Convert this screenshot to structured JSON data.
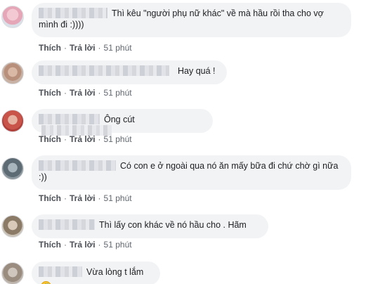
{
  "comments": [
    {
      "text": "Thì kêu \"người phụ nữ khác\" về mà hầu rồi tha cho vợ mình đi :))))",
      "actions": {
        "like": "Thích",
        "reply": "Trả lời",
        "time": "51 phút"
      }
    },
    {
      "text": "Hay quá !",
      "actions": {
        "like": "Thích",
        "reply": "Trả lời",
        "time": "51 phút"
      }
    },
    {
      "text": "Ông cút",
      "actions": {
        "like": "Thích",
        "reply": "Trả lời",
        "time": "51 phút"
      }
    },
    {
      "text": "Có con e ở ngoài qua nó ăn mấy bữa đi chứ chờ gì nữa :))",
      "actions": {
        "like": "Thích",
        "reply": "Trả lời",
        "time": "51 phút"
      }
    },
    {
      "text": "Thì lấy con khác về nó hầu cho . Hãm",
      "actions": {
        "like": "Thích",
        "reply": "Trả lời",
        "time": "51 phút"
      }
    },
    {
      "text": "Vừa lòng t lắm",
      "emoji": "rolling-on-floor-laughing",
      "emoji_char": "🤣"
    }
  ],
  "dot_separator": "·",
  "colors": {
    "bubble_bg": "#f2f3f5",
    "action_text": "#4b4f56",
    "meta_text": "#606770"
  }
}
